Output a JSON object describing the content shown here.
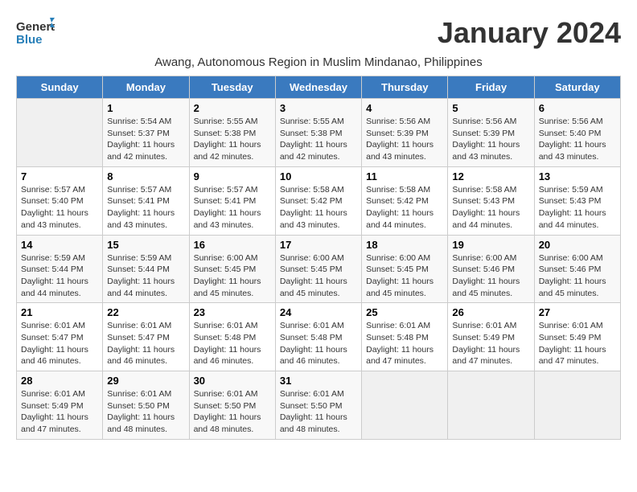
{
  "header": {
    "logo_general": "General",
    "logo_blue": "Blue",
    "month_title": "January 2024",
    "subtitle": "Awang, Autonomous Region in Muslim Mindanao, Philippines"
  },
  "weekdays": [
    "Sunday",
    "Monday",
    "Tuesday",
    "Wednesday",
    "Thursday",
    "Friday",
    "Saturday"
  ],
  "weeks": [
    [
      {
        "day": "",
        "info": ""
      },
      {
        "day": "1",
        "info": "Sunrise: 5:54 AM\nSunset: 5:37 PM\nDaylight: 11 hours\nand 42 minutes."
      },
      {
        "day": "2",
        "info": "Sunrise: 5:55 AM\nSunset: 5:38 PM\nDaylight: 11 hours\nand 42 minutes."
      },
      {
        "day": "3",
        "info": "Sunrise: 5:55 AM\nSunset: 5:38 PM\nDaylight: 11 hours\nand 42 minutes."
      },
      {
        "day": "4",
        "info": "Sunrise: 5:56 AM\nSunset: 5:39 PM\nDaylight: 11 hours\nand 43 minutes."
      },
      {
        "day": "5",
        "info": "Sunrise: 5:56 AM\nSunset: 5:39 PM\nDaylight: 11 hours\nand 43 minutes."
      },
      {
        "day": "6",
        "info": "Sunrise: 5:56 AM\nSunset: 5:40 PM\nDaylight: 11 hours\nand 43 minutes."
      }
    ],
    [
      {
        "day": "7",
        "info": "Sunrise: 5:57 AM\nSunset: 5:40 PM\nDaylight: 11 hours\nand 43 minutes."
      },
      {
        "day": "8",
        "info": "Sunrise: 5:57 AM\nSunset: 5:41 PM\nDaylight: 11 hours\nand 43 minutes."
      },
      {
        "day": "9",
        "info": "Sunrise: 5:57 AM\nSunset: 5:41 PM\nDaylight: 11 hours\nand 43 minutes."
      },
      {
        "day": "10",
        "info": "Sunrise: 5:58 AM\nSunset: 5:42 PM\nDaylight: 11 hours\nand 43 minutes."
      },
      {
        "day": "11",
        "info": "Sunrise: 5:58 AM\nSunset: 5:42 PM\nDaylight: 11 hours\nand 44 minutes."
      },
      {
        "day": "12",
        "info": "Sunrise: 5:58 AM\nSunset: 5:43 PM\nDaylight: 11 hours\nand 44 minutes."
      },
      {
        "day": "13",
        "info": "Sunrise: 5:59 AM\nSunset: 5:43 PM\nDaylight: 11 hours\nand 44 minutes."
      }
    ],
    [
      {
        "day": "14",
        "info": "Sunrise: 5:59 AM\nSunset: 5:44 PM\nDaylight: 11 hours\nand 44 minutes."
      },
      {
        "day": "15",
        "info": "Sunrise: 5:59 AM\nSunset: 5:44 PM\nDaylight: 11 hours\nand 44 minutes."
      },
      {
        "day": "16",
        "info": "Sunrise: 6:00 AM\nSunset: 5:45 PM\nDaylight: 11 hours\nand 45 minutes."
      },
      {
        "day": "17",
        "info": "Sunrise: 6:00 AM\nSunset: 5:45 PM\nDaylight: 11 hours\nand 45 minutes."
      },
      {
        "day": "18",
        "info": "Sunrise: 6:00 AM\nSunset: 5:45 PM\nDaylight: 11 hours\nand 45 minutes."
      },
      {
        "day": "19",
        "info": "Sunrise: 6:00 AM\nSunset: 5:46 PM\nDaylight: 11 hours\nand 45 minutes."
      },
      {
        "day": "20",
        "info": "Sunrise: 6:00 AM\nSunset: 5:46 PM\nDaylight: 11 hours\nand 45 minutes."
      }
    ],
    [
      {
        "day": "21",
        "info": "Sunrise: 6:01 AM\nSunset: 5:47 PM\nDaylight: 11 hours\nand 46 minutes."
      },
      {
        "day": "22",
        "info": "Sunrise: 6:01 AM\nSunset: 5:47 PM\nDaylight: 11 hours\nand 46 minutes."
      },
      {
        "day": "23",
        "info": "Sunrise: 6:01 AM\nSunset: 5:48 PM\nDaylight: 11 hours\nand 46 minutes."
      },
      {
        "day": "24",
        "info": "Sunrise: 6:01 AM\nSunset: 5:48 PM\nDaylight: 11 hours\nand 46 minutes."
      },
      {
        "day": "25",
        "info": "Sunrise: 6:01 AM\nSunset: 5:48 PM\nDaylight: 11 hours\nand 47 minutes."
      },
      {
        "day": "26",
        "info": "Sunrise: 6:01 AM\nSunset: 5:49 PM\nDaylight: 11 hours\nand 47 minutes."
      },
      {
        "day": "27",
        "info": "Sunrise: 6:01 AM\nSunset: 5:49 PM\nDaylight: 11 hours\nand 47 minutes."
      }
    ],
    [
      {
        "day": "28",
        "info": "Sunrise: 6:01 AM\nSunset: 5:49 PM\nDaylight: 11 hours\nand 47 minutes."
      },
      {
        "day": "29",
        "info": "Sunrise: 6:01 AM\nSunset: 5:50 PM\nDaylight: 11 hours\nand 48 minutes."
      },
      {
        "day": "30",
        "info": "Sunrise: 6:01 AM\nSunset: 5:50 PM\nDaylight: 11 hours\nand 48 minutes."
      },
      {
        "day": "31",
        "info": "Sunrise: 6:01 AM\nSunset: 5:50 PM\nDaylight: 11 hours\nand 48 minutes."
      },
      {
        "day": "",
        "info": ""
      },
      {
        "day": "",
        "info": ""
      },
      {
        "day": "",
        "info": ""
      }
    ]
  ]
}
